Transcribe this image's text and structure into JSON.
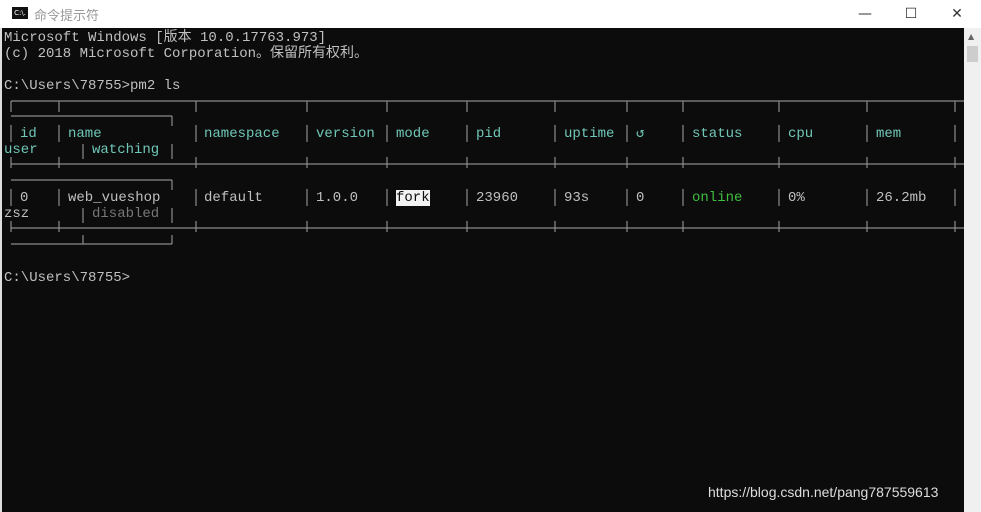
{
  "window": {
    "title": "命令提示符",
    "icon_label": "C:\\.",
    "minimize": "—",
    "maximize": "☐",
    "close": "✕"
  },
  "console": {
    "line1": "Microsoft Windows [版本 10.0.17763.973]",
    "line2": "(c) 2018 Microsoft Corporation。保留所有权利。",
    "command_prompt": "C:\\Users\\78755>pm2 ls",
    "final_prompt": "C:\\Users\\78755>"
  },
  "table": {
    "headers": {
      "id": "id",
      "user": "user",
      "name": "name",
      "watching": "watching",
      "namespace": "namespace",
      "version": "version",
      "mode": "mode",
      "pid": "pid",
      "uptime": "uptime",
      "restarts": "↺",
      "status": "status",
      "cpu": "cpu",
      "mem": "mem"
    },
    "rows": [
      {
        "id": "0",
        "user": "zsz",
        "name": "web_vueshop",
        "watching": "disabled",
        "namespace": "default",
        "version": "1.0.0",
        "mode": "fork",
        "pid": "23960",
        "uptime": "93s",
        "restarts": "0",
        "status": "online",
        "cpu": "0%",
        "mem": "26.2mb"
      }
    ]
  },
  "watermark": "https://blog.csdn.net/pang787559613"
}
